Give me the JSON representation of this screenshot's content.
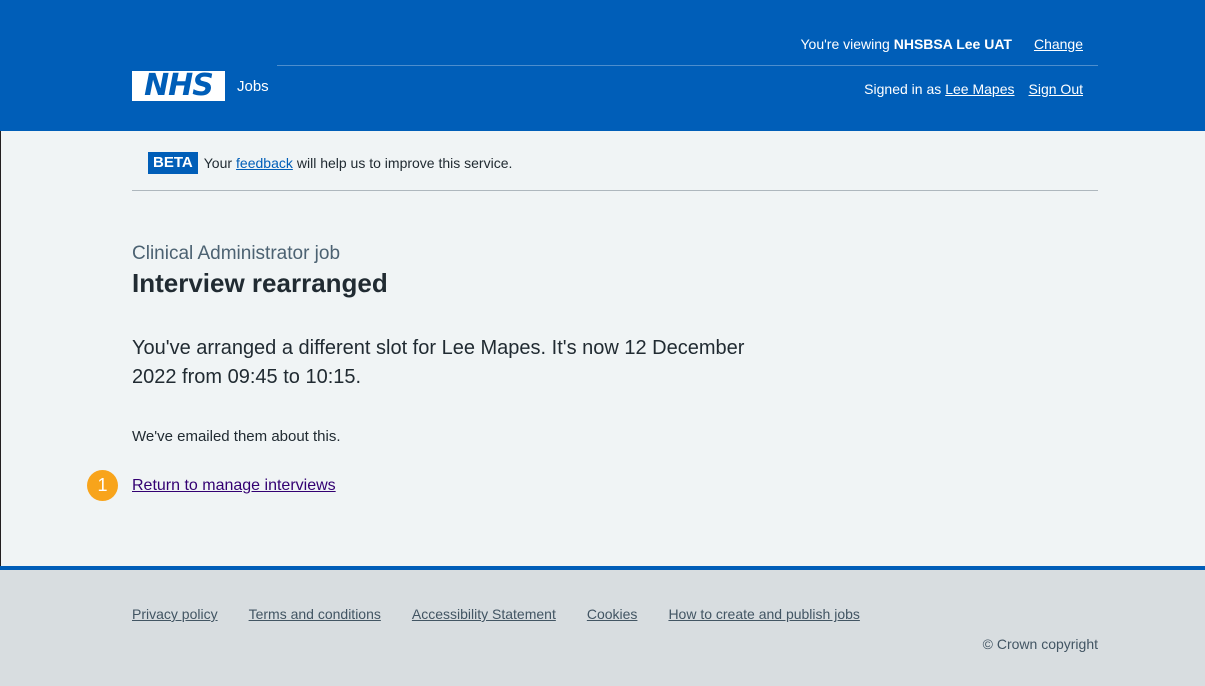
{
  "header": {
    "org_prefix": "You're viewing",
    "org_name": "NHSBSA Lee UAT",
    "change_label": "Change",
    "logo_text": "NHS",
    "service_name": "Jobs",
    "signed_in_prefix": "Signed in as",
    "user_name": "Lee Mapes",
    "sign_out_label": "Sign Out"
  },
  "phase_banner": {
    "tag": "BETA",
    "text_before": "Your",
    "feedback_link": "feedback",
    "text_after": "will help us to improve this service."
  },
  "main": {
    "caption": "Clinical Administrator job",
    "title": "Interview rearranged",
    "lede": "You've arranged a different slot for Lee Mapes. It's now 12 December 2022 from 09:45 to 10:15.",
    "body": "We've emailed them about this.",
    "return_link": "Return to manage interviews"
  },
  "annotation": {
    "step_number": "1",
    "color": "#f8a41b"
  },
  "footer": {
    "links": [
      "Privacy policy",
      "Terms and conditions",
      "Accessibility Statement",
      "Cookies",
      "How to create and publish jobs"
    ],
    "copyright": "© Crown copyright"
  },
  "colors": {
    "header_bg": "#005eb8",
    "page_bg": "#f0f4f5",
    "footer_bg": "#d8dde0",
    "visited_link": "#330072"
  }
}
